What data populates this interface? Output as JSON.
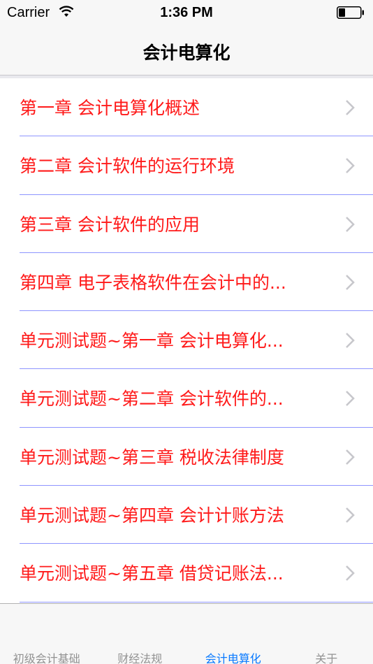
{
  "status_bar": {
    "carrier": "Carrier",
    "time": "1:36 PM"
  },
  "nav": {
    "title": "会计电算化"
  },
  "list": {
    "items": [
      {
        "label": "第一章 会计电算化概述"
      },
      {
        "label": "第二章 会计软件的运行环境"
      },
      {
        "label": "第三章 会计软件的应用"
      },
      {
        "label": "第四章 电子表格软件在会计中的..."
      },
      {
        "label": "单元测试题~第一章 会计电算化..."
      },
      {
        "label": "单元测试题~第二章 会计软件的..."
      },
      {
        "label": "单元测试题~第三章 税收法律制度"
      },
      {
        "label": "单元测试题~第四章 会计计账方法"
      },
      {
        "label": "单元测试题~第五章 借贷记账法..."
      }
    ]
  },
  "tab_bar": {
    "tabs": [
      {
        "label": "初级会计基础"
      },
      {
        "label": "财经法规"
      },
      {
        "label": "会计电算化"
      },
      {
        "label": "关于"
      }
    ],
    "active_index": 2
  },
  "colors": {
    "item_text": "#ff1a1a",
    "separator": "#8e95ff",
    "active_tab": "#0a7aff",
    "inactive_tab": "#929292"
  }
}
